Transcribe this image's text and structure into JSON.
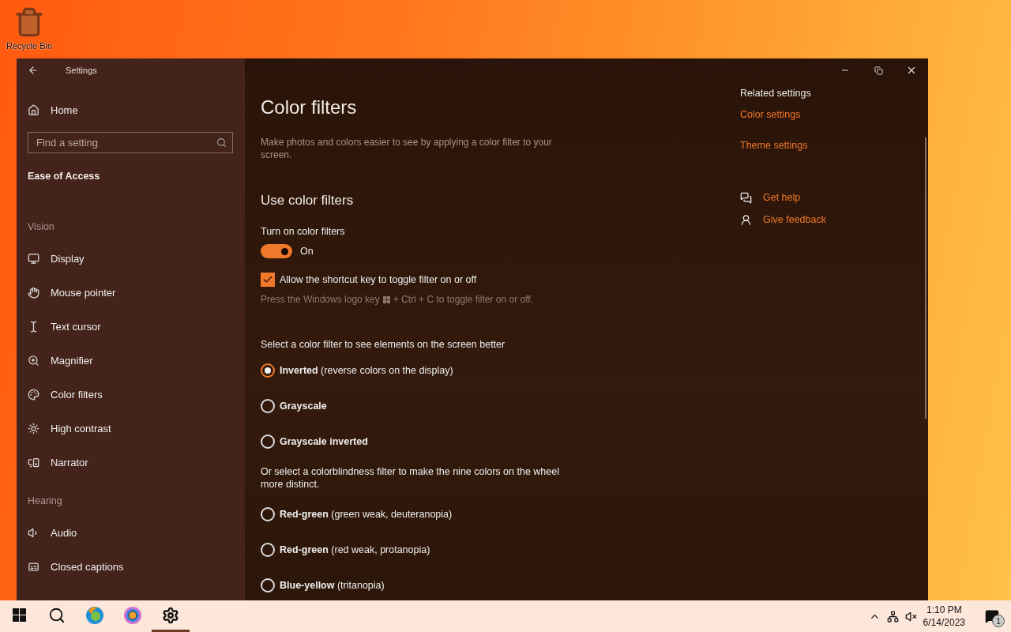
{
  "desktop": {
    "icons": [
      {
        "label": "Recycle Bin"
      }
    ]
  },
  "window": {
    "title": "Settings"
  },
  "sidebar": {
    "home": "Home",
    "search": {
      "placeholder": "Find a setting"
    },
    "heading": "Ease of Access",
    "groups": [
      {
        "title": "Vision",
        "items": [
          {
            "kind": "display",
            "label": "Display"
          },
          {
            "kind": "mouse",
            "label": "Mouse pointer"
          },
          {
            "kind": "cursor",
            "label": "Text cursor"
          },
          {
            "kind": "magnifier",
            "label": "Magnifier"
          },
          {
            "kind": "palette",
            "label": "Color filters"
          },
          {
            "kind": "contrast",
            "label": "High contrast"
          },
          {
            "kind": "narrator",
            "label": "Narrator"
          }
        ]
      },
      {
        "title": "Hearing",
        "items": [
          {
            "kind": "audio",
            "label": "Audio"
          },
          {
            "kind": "captions",
            "label": "Closed captions"
          }
        ]
      }
    ]
  },
  "content": {
    "title": "Color filters",
    "description": "Make photos and colors easier to see by applying a color filter to your screen.",
    "section": "Use color filters",
    "toggle": {
      "label": "Turn on color filters",
      "on": true,
      "state_text": "On"
    },
    "shortcut": {
      "label": "Allow the shortcut key to toggle filter on or off",
      "checked": true,
      "hint_before": "Press the Windows logo key",
      "hint_after": "+ Ctrl + C to toggle filter on or off."
    },
    "filter_prompt": "Select a color filter to see elements on the screen better",
    "filters": [
      {
        "name": "Inverted",
        "detail": "(reverse colors on the display)",
        "selected": true
      },
      {
        "name": "Grayscale",
        "selected": false
      },
      {
        "name": "Grayscale inverted",
        "selected": false
      }
    ],
    "colorblind_prompt": "Or select a colorblindness filter to make the nine colors on the wheel more distinct.",
    "colorblind_filters": [
      {
        "name": "Red-green",
        "detail": "(green weak, deuteranopia)",
        "selected": false
      },
      {
        "name": "Red-green",
        "detail": "(red weak, protanopia)",
        "selected": false
      },
      {
        "name": "Blue-yellow",
        "detail": "(tritanopia)",
        "selected": false
      }
    ]
  },
  "related": {
    "title": "Related settings",
    "links": [
      "Color settings",
      "Theme settings"
    ],
    "help": [
      {
        "kind": "help",
        "label": "Get help"
      },
      {
        "kind": "feedback",
        "label": "Give feedback"
      }
    ]
  },
  "taskbar": {
    "apps": [
      {
        "kind": "search",
        "active": false
      },
      {
        "kind": "firefox",
        "active": false
      },
      {
        "kind": "chrome",
        "active": false
      },
      {
        "kind": "settings",
        "active": true
      }
    ],
    "time": "1:10 PM",
    "date": "6/14/2023",
    "notifications": "1"
  }
}
